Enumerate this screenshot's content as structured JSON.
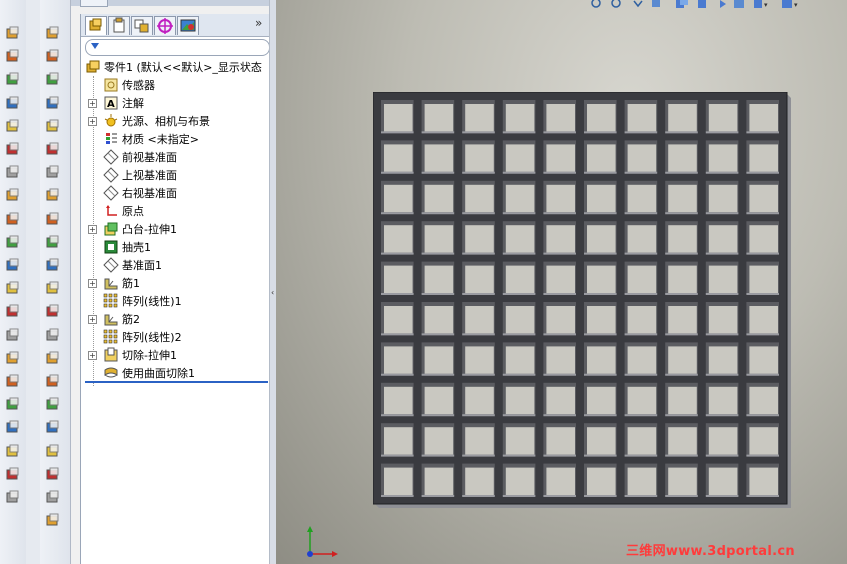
{
  "feature_manager": {
    "filter_placeholder": "",
    "more_label": "»",
    "root_label": "零件1  (默认<<默认>_显示状态",
    "items": [
      {
        "label": "传感器",
        "expandable": false,
        "icon": "sensor-icon"
      },
      {
        "label": "注解",
        "expandable": true,
        "icon": "annotation-icon"
      },
      {
        "label": "光源、相机与布景",
        "expandable": true,
        "icon": "lights-icon"
      },
      {
        "label": "材质 <未指定>",
        "expandable": false,
        "icon": "material-icon"
      },
      {
        "label": "前视基准面",
        "expandable": false,
        "icon": "plane-icon"
      },
      {
        "label": "上视基准面",
        "expandable": false,
        "icon": "plane-icon"
      },
      {
        "label": "右视基准面",
        "expandable": false,
        "icon": "plane-icon"
      },
      {
        "label": "原点",
        "expandable": false,
        "icon": "origin-icon"
      },
      {
        "label": "凸台-拉伸1",
        "expandable": true,
        "icon": "extrude-icon"
      },
      {
        "label": "抽壳1",
        "expandable": false,
        "icon": "shell-icon"
      },
      {
        "label": "基准面1",
        "expandable": false,
        "icon": "plane-icon"
      },
      {
        "label": "筋1",
        "expandable": true,
        "icon": "rib-icon"
      },
      {
        "label": "阵列(线性)1",
        "expandable": false,
        "icon": "linear-pattern-icon"
      },
      {
        "label": "筋2",
        "expandable": true,
        "icon": "rib-icon"
      },
      {
        "label": "阵列(线性)2",
        "expandable": false,
        "icon": "linear-pattern-icon"
      },
      {
        "label": "切除-拉伸1",
        "expandable": true,
        "icon": "cut-extrude-icon"
      },
      {
        "label": "使用曲面切除1",
        "expandable": false,
        "icon": "surface-cut-icon"
      }
    ]
  },
  "part": {
    "rows": 10,
    "cols": 10
  },
  "watermark": "三维网www.3dportal.cn",
  "colors": {
    "accent": "#2b62c4",
    "watermark": "#ff3b3b",
    "part_face": "#3a3b40"
  }
}
